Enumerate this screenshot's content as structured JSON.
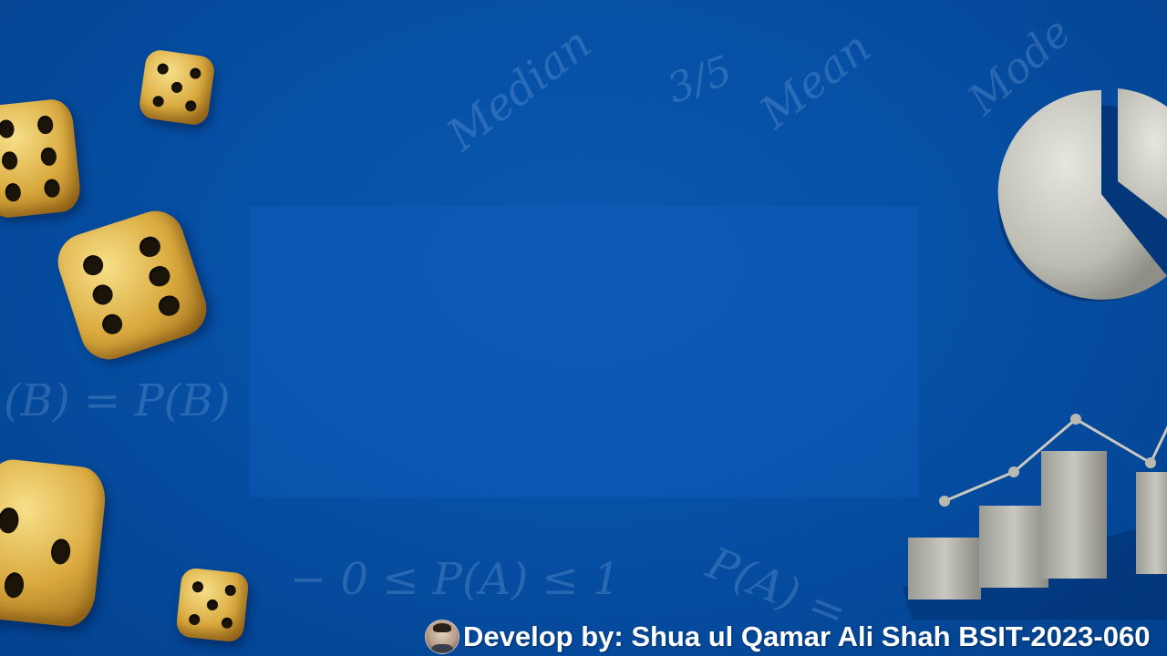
{
  "background": {
    "color": "#0650a6",
    "math_texts": {
      "median": "Median",
      "fraction": "3/5",
      "mean": "Mean",
      "mode": "Mode",
      "eq_b": "(B) = P(B)",
      "eq_prob_range": "− 0 ≤ P(A) ≤ 1",
      "eq_pa": "P(A) ="
    }
  },
  "decorations": {
    "dice_color": "#d9a93e",
    "pie_chart_icon": "pie-chart-icon",
    "bar_chart_icon": "bar-chart-icon"
  },
  "footer": {
    "avatar_icon": "avatar",
    "credit": "Develop by: Shua ul Qamar Ali Shah BSIT-2023-060"
  }
}
